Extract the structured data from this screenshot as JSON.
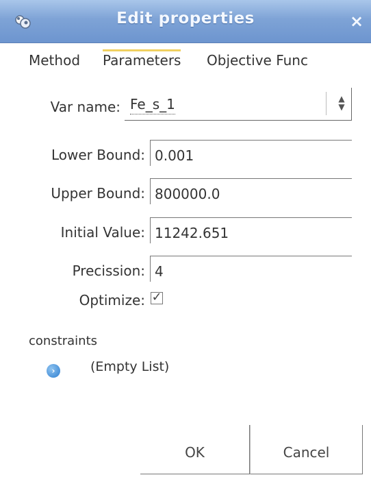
{
  "window": {
    "title": "Edit properties",
    "close_symbol": "×"
  },
  "tabs": [
    {
      "label": "Method",
      "active": false
    },
    {
      "label": "Parameters",
      "active": true
    },
    {
      "label": "Objective Func",
      "active": false
    }
  ],
  "form": {
    "var_name": {
      "label": "Var name:",
      "value": "Fe_s_1"
    },
    "lower_bound": {
      "label": "Lower Bound:",
      "value": "0.001"
    },
    "upper_bound": {
      "label": "Upper Bound:",
      "value": "800000.0"
    },
    "initial_value": {
      "label": "Initial Value:",
      "value": "11242.651"
    },
    "precision": {
      "label": "Precission:",
      "value": "4"
    },
    "optimize": {
      "label": "Optimize:",
      "checked": true
    }
  },
  "constraints": {
    "title": "constraints",
    "empty_text": "(Empty List)"
  },
  "buttons": {
    "ok": "OK",
    "cancel": "Cancel"
  },
  "colors": {
    "titlebar": "#7ea3d6",
    "active_tab_marker": "#f0d060",
    "expand_icon": "#2f7fd0"
  }
}
